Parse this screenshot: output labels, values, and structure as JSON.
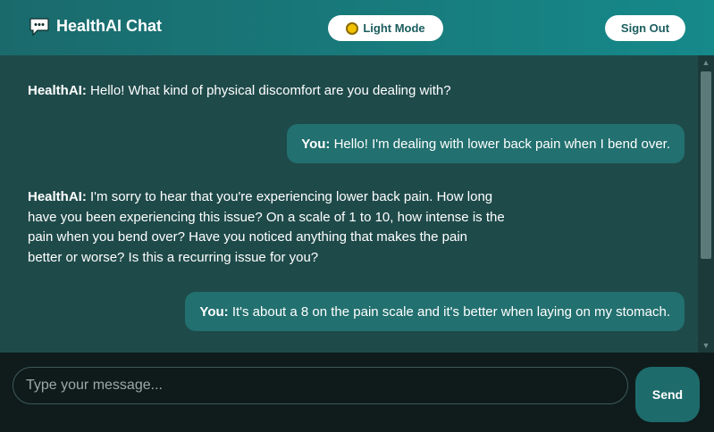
{
  "header": {
    "title": "HealthAI Chat",
    "chat_icon": "chat-bubble-icon",
    "theme_icon": "sun-icon",
    "light_mode_label": "Light Mode",
    "sign_out_label": "Sign Out"
  },
  "messages": [
    {
      "sender": "HealthAI:",
      "text": "Hello! What kind of physical discomfort are you dealing with?"
    },
    {
      "sender": "You:",
      "text": "Hello! I'm dealing with lower back pain when I bend over."
    },
    {
      "sender": "HealthAI:",
      "lines": [
        "I'm sorry to hear that you're experiencing lower back pain. How long",
        "have you been experiencing this issue? On a scale of 1 to 10, how intense is the",
        "pain when you bend over? Have you noticed anything that makes the pain",
        "better or worse? Is this a recurring issue for you?"
      ]
    },
    {
      "sender": "You:",
      "text": "It's about a 8 on the pain scale and it's better when laying on my stomach."
    }
  ],
  "composer": {
    "placeholder": "Type your message...",
    "value": "",
    "send_label": "Send"
  },
  "colors": {
    "header_start": "#1a6a6c",
    "header_end": "#16898a",
    "chat_bg": "#1f4a4a",
    "user_bubble": "#22706f",
    "send_button": "#1e6b6c"
  }
}
